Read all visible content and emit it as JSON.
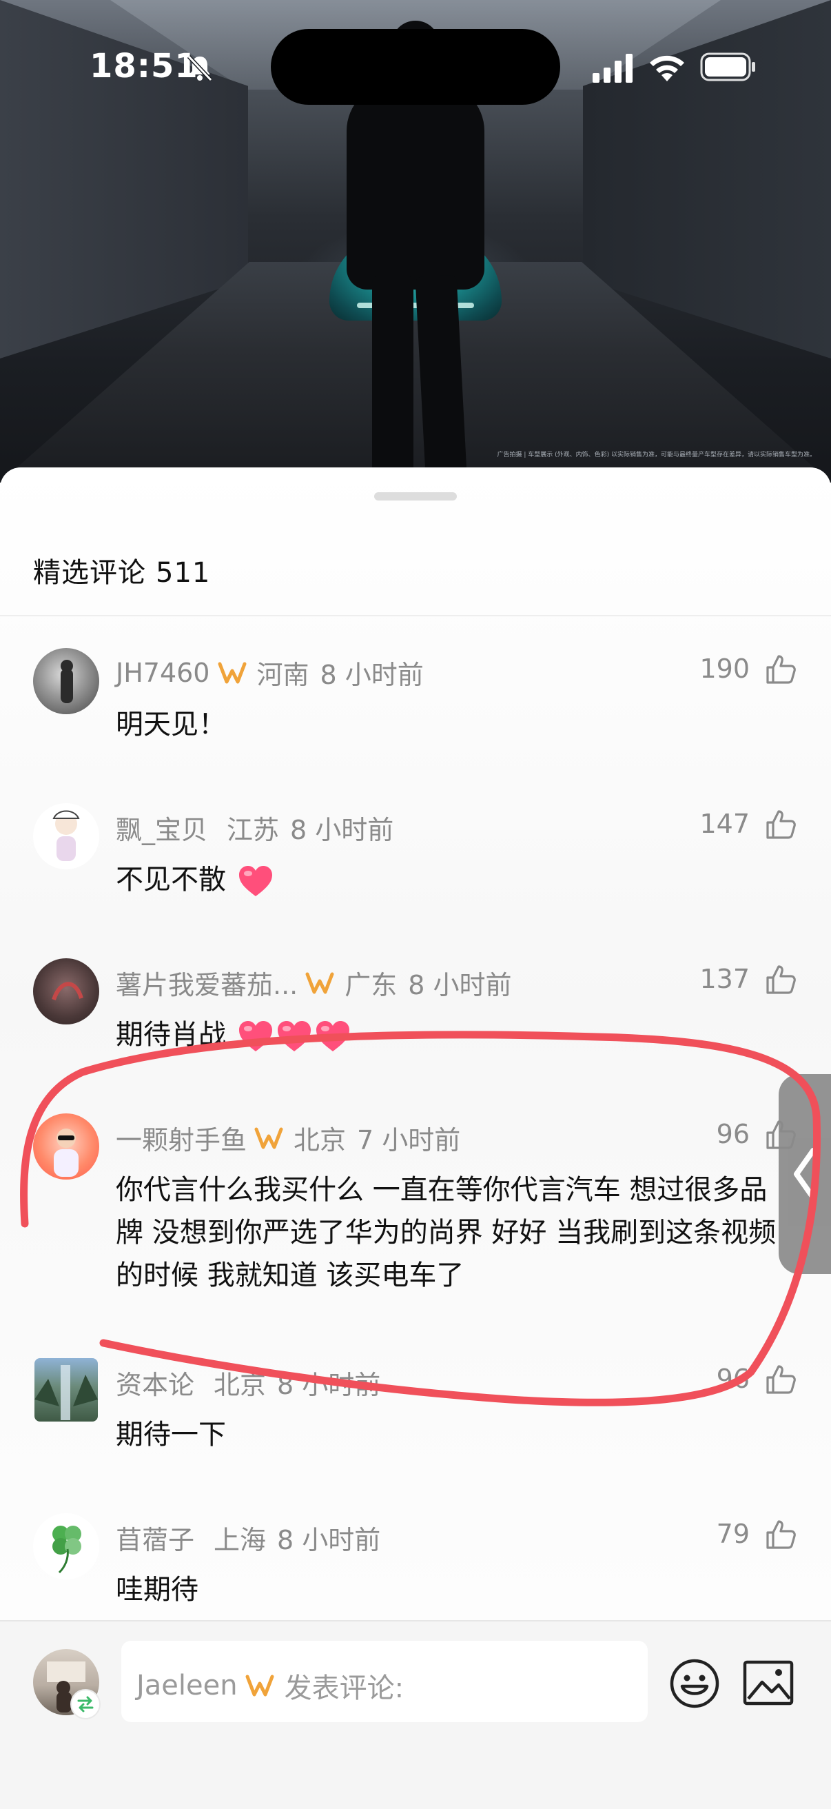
{
  "status_bar": {
    "time": "18:51"
  },
  "hero": {
    "disclaimer": "广告拍摄 | 车型展示 (外观、内饰、色彩) 以实际销售为准，可能与最终量产车型存在差异，请以实际销售车型为准。"
  },
  "comments_panel": {
    "title": "精选评论",
    "count": "511"
  },
  "comments": [
    {
      "user": "JH7460",
      "vip": true,
      "location": "河南",
      "time": "8 小时前",
      "likes": "190",
      "text": "明天见！",
      "hearts": 0
    },
    {
      "user": "飘_宝贝",
      "vip": false,
      "location": "江苏",
      "time": "8 小时前",
      "likes": "147",
      "text": "不见不散",
      "hearts": 1
    },
    {
      "user": "薯片我爱蕃茄...",
      "vip": true,
      "location": "广东",
      "time": "8 小时前",
      "likes": "137",
      "text": "期待肖战",
      "hearts": 3
    },
    {
      "user": "一颗射手鱼",
      "vip": true,
      "location": "北京",
      "time": "7 小时前",
      "likes": "96",
      "text": "你代言什么我买什么 一直在等你代言汽车 想过很多品牌 没想到你严选了华为的尚界 好好 当我刷到这条视频的时候 我就知道 该买电车了",
      "hearts": 0
    },
    {
      "user": "资本论",
      "vip": false,
      "location": "北京",
      "time": "8 小时前",
      "likes": "96",
      "text": "期待一下",
      "hearts": 0
    },
    {
      "user": "苜蓿子",
      "vip": false,
      "location": "上海",
      "time": "8 小时前",
      "likes": "79",
      "text": "哇期待",
      "hearts": 0
    }
  ],
  "input_bar": {
    "username": "Jaeleen",
    "placeholder": "发表评论:"
  },
  "colors": {
    "vip_gold": "#f0a33a",
    "highlight_red": "#f0505a",
    "heart_pink": "#ff4f7b"
  },
  "icons": {
    "like": "thumbs-up-icon",
    "emoji": "smiley-icon",
    "image": "image-icon",
    "vip": "vip-badge-icon"
  }
}
